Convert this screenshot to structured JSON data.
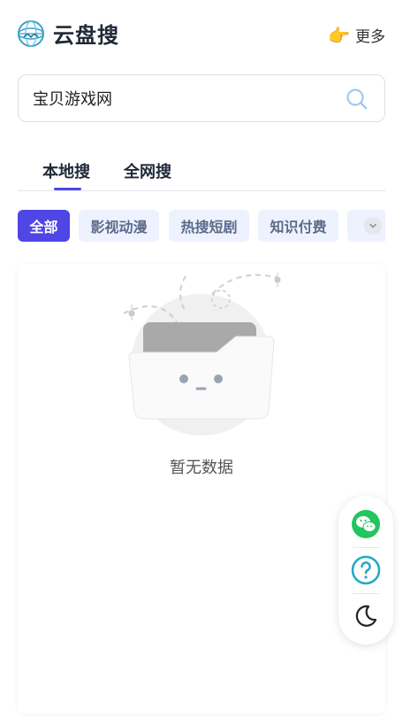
{
  "header": {
    "brand": "云盘搜",
    "more_label": "更多",
    "more_icon": "pointing-hand-icon",
    "logo_icon": "cloud-globe-logo"
  },
  "search": {
    "value": "宝贝游戏网",
    "icon": "search-icon"
  },
  "tabs": [
    {
      "label": "本地搜",
      "active": true
    },
    {
      "label": "全网搜",
      "active": false
    }
  ],
  "filters": {
    "items": [
      {
        "label": "全部",
        "active": true
      },
      {
        "label": "影视动漫",
        "active": false
      },
      {
        "label": "热搜短剧",
        "active": false
      },
      {
        "label": "知识付费",
        "active": false
      }
    ],
    "expand_icon": "chevron-down-icon"
  },
  "empty_state": {
    "message": "暂无数据",
    "icon": "empty-folder-icon"
  },
  "float_toolbar": {
    "icons": [
      "wechat-icon",
      "help-icon",
      "moon-icon"
    ]
  },
  "colors": {
    "accent": "#4f46e5",
    "chip_bg": "#eef2ff",
    "wechat": "#22c55e",
    "help": "#26a9c6"
  }
}
